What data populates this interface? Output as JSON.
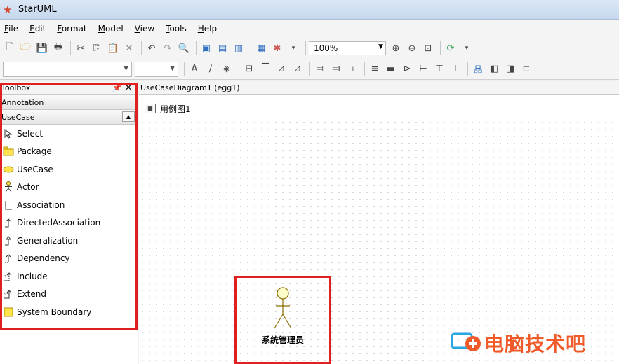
{
  "window": {
    "title": "StarUML"
  },
  "menu": {
    "items": [
      "File",
      "Edit",
      "Format",
      "Model",
      "View",
      "Tools",
      "Help"
    ]
  },
  "toolbar": {
    "zoom_value": "100%"
  },
  "toolbox": {
    "header": "Toolbox",
    "sections": {
      "annotation": "Annotation",
      "usecase": "UseCase"
    },
    "items": [
      {
        "label": "Select",
        "icon": "cursor-icon"
      },
      {
        "label": "Package",
        "icon": "package-icon"
      },
      {
        "label": "UseCase",
        "icon": "usecase-icon"
      },
      {
        "label": "Actor",
        "icon": "actor-icon"
      },
      {
        "label": "Association",
        "icon": "association-icon"
      },
      {
        "label": "DirectedAssociation",
        "icon": "directed-association-icon"
      },
      {
        "label": "Generalization",
        "icon": "generalization-icon"
      },
      {
        "label": "Dependency",
        "icon": "dependency-icon"
      },
      {
        "label": "Include",
        "icon": "include-icon"
      },
      {
        "label": "Extend",
        "icon": "extend-icon"
      },
      {
        "label": "System Boundary",
        "icon": "system-boundary-icon"
      }
    ]
  },
  "diagram": {
    "header": "UseCaseDiagram1 (egg1)",
    "tab_label": "用例图1",
    "actor_name": "系统管理员"
  },
  "watermark": {
    "text": "电脑技术吧"
  },
  "colors": {
    "highlight": "#e02020",
    "watermark": "#f05a28"
  }
}
